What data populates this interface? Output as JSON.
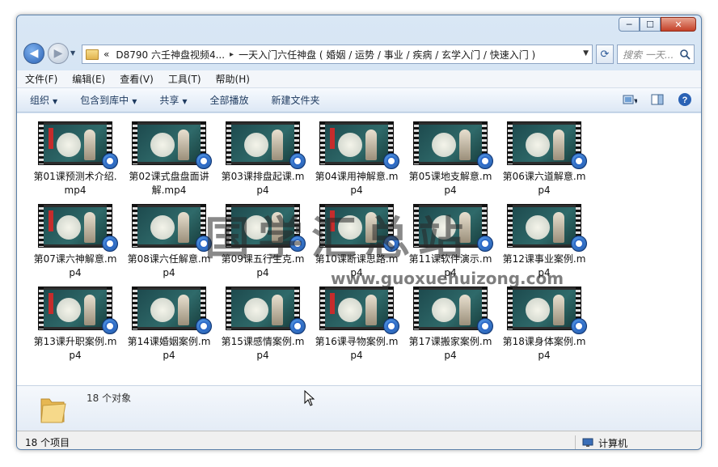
{
  "window": {
    "minimize": "─",
    "maximize": "☐",
    "close": "✕"
  },
  "address": {
    "lead": "«",
    "crumbs": [
      "D8790 六壬神盘视频4...",
      "一天入门六任神盘 ( 婚姻 / 运势 / 事业 / 疾病 / 玄学入门 / 快速入门 )"
    ],
    "sep": "▸"
  },
  "search": {
    "placeholder": "搜索 一天..."
  },
  "menu": [
    "文件(F)",
    "编辑(E)",
    "查看(V)",
    "工具(T)",
    "帮助(H)"
  ],
  "toolbar": {
    "organize": "组织",
    "include": "包含到库中",
    "share": "共享",
    "playall": "全部播放",
    "newfolder": "新建文件夹"
  },
  "files": [
    "第01课预测术介绍.mp4",
    "第02课式盘盘面讲解.mp4",
    "第03课排盘起课.mp4",
    "第04课用神解意.mp4",
    "第05课地支解意.mp4",
    "第06课六道解意.mp4",
    "第07课六神解意.mp4",
    "第08课六任解意.mp4",
    "第09课五行生克.mp4",
    "第10课断课思路.mp4",
    "第11课软件演示.mp4",
    "第12课事业案例.mp4",
    "第13课升职案例.mp4",
    "第14课婚姻案例.mp4",
    "第15课感情案例.mp4",
    "第16课寻物案例.mp4",
    "第17课搬家案例.mp4",
    "第18课身体案例.mp4"
  ],
  "watermark": {
    "text": "国学汇总站",
    "url": "www.guoxuehuizong.com"
  },
  "details": {
    "count": "18 个对象"
  },
  "status": {
    "items": "18 个项目",
    "location": "计算机"
  },
  "colors": {
    "accent": "#2a62b5",
    "badge": "#1a4fa0"
  }
}
